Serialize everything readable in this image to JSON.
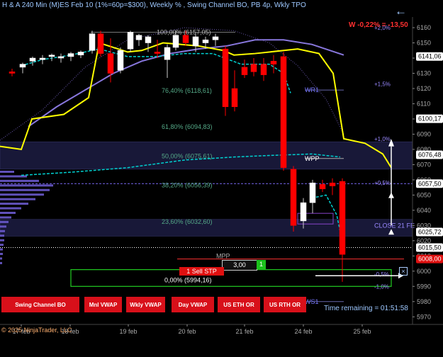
{
  "header": {
    "title": "H & A 240 Min (M)ES Feb 10  (1%=60p=$300), Weekly % , Swing Channel BO, PB 4p, Wkly TPO",
    "weekly_change": "W -0,22% = -13,50"
  },
  "colors": {
    "background": "#000000",
    "up_candle": "#ffffff",
    "down_candle": "#ff0000",
    "swing_line": "#ffff00",
    "ma_line": "#8877dd",
    "cyan_line": "#00d0d0",
    "price_axis_label": "#ffffff"
  },
  "fib_levels": [
    {
      "label": "100,00% (6157,05)",
      "price": 6157.05
    },
    {
      "label": "76,40% (6118,61)",
      "price": 6118.61
    },
    {
      "label": "61,80% (6094,83)",
      "price": 6094.83
    },
    {
      "label": "50,00% (6075,61)",
      "price": 6075.61
    },
    {
      "label": "38,20% (6056,39)",
      "price": 6056.39
    },
    {
      "label": "23,60% (6032,60)",
      "price": 6032.6
    },
    {
      "label": "0,00% (5994,16)",
      "price": 5994.16
    }
  ],
  "pct_levels": [
    {
      "label": "+2,0%",
      "price": 6160
    },
    {
      "label": "+1,5%",
      "price": 6123
    },
    {
      "label": "+1,0%",
      "price": 6087
    },
    {
      "label": "+0,5%",
      "price": 6058
    },
    {
      "label": "-0,5%",
      "price": 5998
    },
    {
      "label": "-1,0%",
      "price": 5990
    }
  ],
  "level_labels": [
    {
      "label": "WR1",
      "price": 6119
    },
    {
      "label": "WPP",
      "price": 6074
    },
    {
      "label": "CLOSE 21 FE",
      "price": 6030
    },
    {
      "label": "WS1",
      "price": 5980
    },
    {
      "label": "MPP",
      "price": 6010
    }
  ],
  "price_axis": {
    "ticks": [
      6160,
      6150,
      6140,
      6130,
      6120,
      6110,
      6100,
      6090,
      6080,
      6070,
      6060,
      6050,
      6040,
      6030,
      6020,
      6010,
      6000,
      5990,
      5980,
      5970
    ],
    "min": 5965,
    "max": 6167,
    "highlights": [
      {
        "value": "6141,06",
        "price": 6141.06,
        "bg": "#ffffff",
        "fg": "#000000"
      },
      {
        "value": "6100,17",
        "price": 6100.17,
        "bg": "#ffffff",
        "fg": "#000000"
      },
      {
        "value": "6076,48",
        "price": 6076.48,
        "bg": "#ffffff",
        "fg": "#000000"
      },
      {
        "value": "6057,50",
        "price": 6057.5,
        "bg": "#ffffff",
        "fg": "#000000"
      },
      {
        "value": "6025,72",
        "price": 6025.72,
        "bg": "#ffffff",
        "fg": "#000000"
      },
      {
        "value": "6015,50",
        "price": 6015.5,
        "bg": "#ffffff",
        "fg": "#000000"
      },
      {
        "value": "6008,00",
        "price": 6008.0,
        "bg": "#e01010",
        "fg": "#ffffff"
      }
    ]
  },
  "date_axis": [
    "17 feb",
    "18 feb",
    "19 feb",
    "20 feb",
    "21 feb",
    "24 feb",
    "25 feb"
  ],
  "order": {
    "quantity": "3,00",
    "count": "1",
    "sell_label": "1  Sell STP",
    "close_symbol": "×"
  },
  "buttons": [
    {
      "label": "Swing Channel BO"
    },
    {
      "label": "Mnl VWAP"
    },
    {
      "label": "Wkly VWAP"
    },
    {
      "label": "Day VWAP"
    },
    {
      "label": "US ETH OR"
    },
    {
      "label": "US RTH OR"
    }
  ],
  "footer": {
    "copyright": "© 2025 NinjaTrader, LLC",
    "time_remaining": "Time remaining = 01:51:58"
  }
}
